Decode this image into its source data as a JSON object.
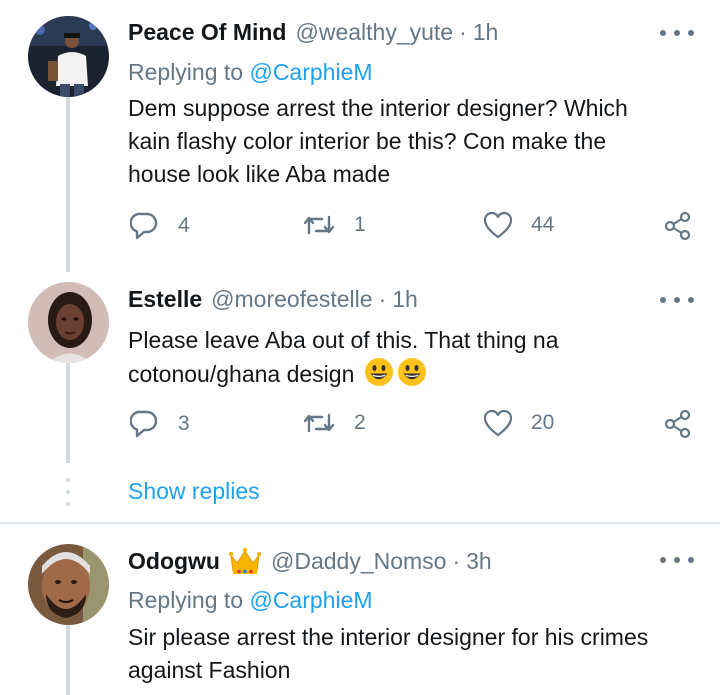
{
  "tweets": [
    {
      "name": "Peace Of Mind",
      "handle": "@wealthy_yute",
      "time": "1h",
      "replying_prefix": "Replying to",
      "replying_to": "@CarphieM",
      "text_lines": [
        "Dem suppose arrest the interior designer? Which",
        "kain flashy color interior be this? Con make the",
        "house look like Aba made"
      ],
      "replies": "4",
      "retweets": "1",
      "likes": "44"
    },
    {
      "name": "Estelle",
      "handle": "@moreofestelle",
      "time": "1h",
      "text_lines": [
        "Please leave Aba out of this. That thing na",
        "cotonou/ghana design"
      ],
      "emoji": "grinning-face-emoji x2",
      "replies": "3",
      "retweets": "2",
      "likes": "20"
    },
    {
      "name": "Odogwu",
      "name_badge": "crown-emoji",
      "handle": "@Daddy_Nomso",
      "time": "3h",
      "replying_prefix": "Replying to",
      "replying_to": "@CarphieM",
      "text_lines": [
        "Sir please arrest the interior designer for his crimes",
        "against Fashion"
      ]
    }
  ],
  "show_replies": "Show replies",
  "separator": "·",
  "colors": {
    "text": "#14171a",
    "muted": "#657786",
    "link": "#1da1f2",
    "thread_line": "#cfd9de"
  }
}
